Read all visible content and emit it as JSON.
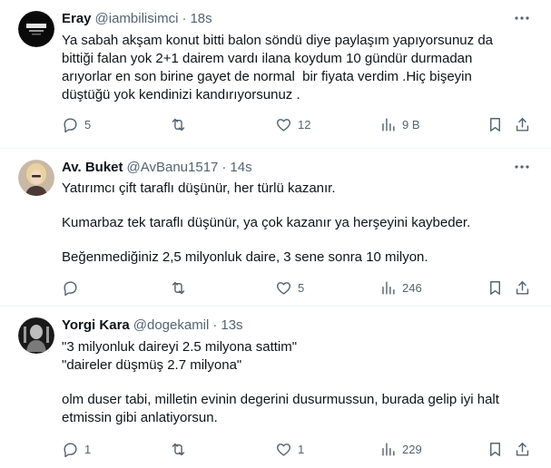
{
  "tweets": [
    {
      "name": "Eray",
      "handle": "@iambilisimci",
      "separator": "·",
      "time": "18s",
      "lines": [
        "Ya sabah akşam konut bitti balon söndü diye paylaşım yapıyorsunuz da",
        "bittiği falan yok 2+1 dairem vardı ilana koydum 10 gündür durmadan",
        "arıyorlar en son birine gayet de normal  bir fiyata verdim .Hiç bişeyin",
        "düştüğü yok kendinizi kandırıyorsunuz ."
      ],
      "replies": "5",
      "retweets": "",
      "likes": "12",
      "views": "9 B"
    },
    {
      "name": "Av. Buket",
      "handle": "@AvBanu1517",
      "separator": "·",
      "time": "14s",
      "paragraphs": [
        "Yatırımcı çift taraflı düşünür, her türlü kazanır.",
        "Kumarbaz tek taraflı düşünür, ya çok kazanır ya herşeyini kaybeder.",
        "Beğenmediğiniz 2,5 milyonluk daire, 3 sene sonra 10 milyon."
      ],
      "replies": "",
      "retweets": "",
      "likes": "5",
      "views": "246"
    },
    {
      "name": "Yorgi Kara",
      "handle": "@dogekamil",
      "separator": "·",
      "time": "13s",
      "lines": [
        "\"3 milyonluk daireyi 2.5 milyona sattim\"",
        "\"daireler düşmüş 2.7 milyona\""
      ],
      "lines2": [
        "olm duser tabi, milletin evinin degerini dusurmussun, burada gelip iyi halt",
        "etmissin gibi anlatiyorsun."
      ],
      "replies": "1",
      "retweets": "",
      "likes": "1",
      "views": "229"
    }
  ],
  "icons": {
    "reply": "reply-icon",
    "retweet": "retweet-icon",
    "like": "like-icon",
    "views": "views-icon",
    "bookmark": "bookmark-icon",
    "share": "share-icon",
    "more": "more-icon"
  },
  "colors": {
    "text": "#0f1419",
    "secondary": "#536471",
    "border": "#eff3f4"
  }
}
